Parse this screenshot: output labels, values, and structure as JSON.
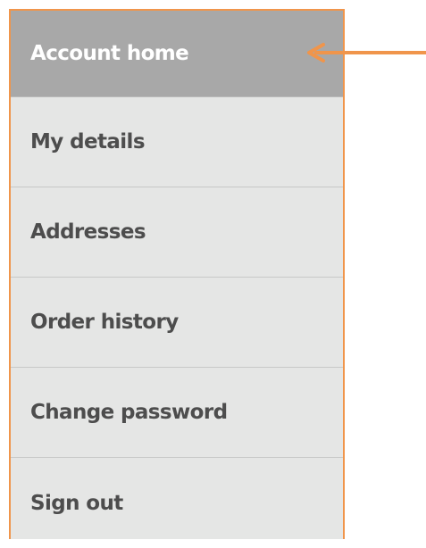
{
  "colors": {
    "accent": "#f0954b",
    "active_bg": "#a8a8a8",
    "item_bg": "#e5e6e5"
  },
  "menu": {
    "items": [
      {
        "label": "Account home",
        "active": true
      },
      {
        "label": "My details",
        "active": false
      },
      {
        "label": "Addresses",
        "active": false
      },
      {
        "label": "Order history",
        "active": false
      },
      {
        "label": "Change password",
        "active": false
      },
      {
        "label": "Sign out",
        "active": false
      }
    ]
  },
  "annotation": {
    "icon": "arrow-left-icon"
  }
}
